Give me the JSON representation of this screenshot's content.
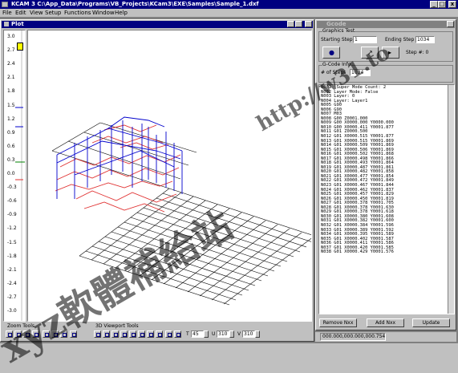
{
  "app": {
    "title": "KCAM 3  C:\\App_Data\\Programs\\VB_Projects\\KCam3\\EXE\\Samples\\Sample_1.dxf",
    "window_buttons": [
      "_",
      "□",
      "x"
    ]
  },
  "menu": [
    "File",
    "Edit",
    "View",
    "Setup",
    "Functions",
    "Window",
    "Help"
  ],
  "plot_window": {
    "title": "Plot",
    "z_scale": [
      "3.0",
      "2.7",
      "2.4",
      "2.1",
      "1.8",
      "1.5",
      "1.2",
      "0.9",
      "0.6",
      "0.3",
      "0.0",
      "-0.3",
      "-0.6",
      "-0.9",
      "-1.2",
      "-1.5",
      "-1.8",
      "-2.1",
      "-2.4",
      "-2.7",
      "-3.0"
    ],
    "zoom_tools_label": "Zoom Tools",
    "viewport_tools_label": "3D Viewport Tools",
    "t_label": "T",
    "t_value": "45",
    "u_label": "U",
    "u_value": "310",
    "v_label": "V",
    "v_value": "310"
  },
  "gcode_window": {
    "title": "Gcode",
    "graphics_test_label": "Graphics Test",
    "starting_step_label": "Starting Step",
    "starting_step_value": "1",
    "ending_step_label": "Ending Step",
    "ending_step_value": "1034",
    "step_label": "Step #: 0",
    "gcode_info_label": "G-Code Info",
    "num_steps_label": "# of Steps",
    "num_steps_value": "1034",
    "lines": [
      "N001 'Super Mode Count: 2",
      "N002 Layer Mode: False",
      "N003 Layer: 0",
      "N004 Layer: Layer1",
      "N005 G90",
      "N006 G90",
      "N007 M03",
      "N008 G00 Z0001.000",
      "N009 G00 X0000.000 Y0000.000",
      "N010 G00 X0000.411 Y0001.877",
      "N011 G01 Z0000.500",
      "N012 G01 X0000.515 Y0001.877",
      "N013 G01 X0000.515 Y0001.869",
      "N014 G01 X0000.509 Y0001.869",
      "N015 G01 X0000.506 Y0001.869",
      "N016 G01 X0000.502 Y0001.868",
      "N017 G01 X0000.498 Y0001.866",
      "N018 G01 X0000.493 Y0001.864",
      "N019 G01 X0000.487 Y0001.861",
      "N020 G01 X0000.482 Y0001.858",
      "N021 G01 X0000.477 Y0001.854",
      "N022 G01 X0000.472 Y0001.849",
      "N023 G01 X0000.467 Y0001.844",
      "N024 G01 X0000.462 Y0001.837",
      "N025 G01 X0000.457 Y0001.829",
      "N026 G01 X0000.450 Y0001.819",
      "N027 G01 X0000.378 Y0001.705",
      "N028 G01 X0000.378 Y0001.630",
      "N029 G01 X0000.378 Y0001.618",
      "N030 G01 X0000.380 Y0001.608",
      "N031 G01 X0000.382 Y0001.600",
      "N032 G01 X0000.384 Y0001.596",
      "N033 G01 X0000.389 Y0001.592",
      "N034 G01 X0000.395 Y0001.589",
      "N035 G01 X0000.402 Y0001.587",
      "N036 G01 X0000.411 Y0001.586",
      "N037 G01 X0000.420 Y0001.585",
      "N038 G01 X0000.429 Y0001.576"
    ],
    "remove_button": "Remove Nxx",
    "add_button": "Add Nxx",
    "update_button": "Update"
  },
  "status_bar": {
    "coords": "000.000,000.000,000.754"
  },
  "watermark": {
    "text1": "xyz軟體補給站",
    "text2": "http://w31.to"
  },
  "colors": {
    "title_active": "#000080",
    "title_inactive": "#808080",
    "face": "#c0c0c0",
    "mdi_bg": "#808080",
    "path_blue": "#0000cc",
    "path_red": "#e03030",
    "grid": "#000000"
  }
}
